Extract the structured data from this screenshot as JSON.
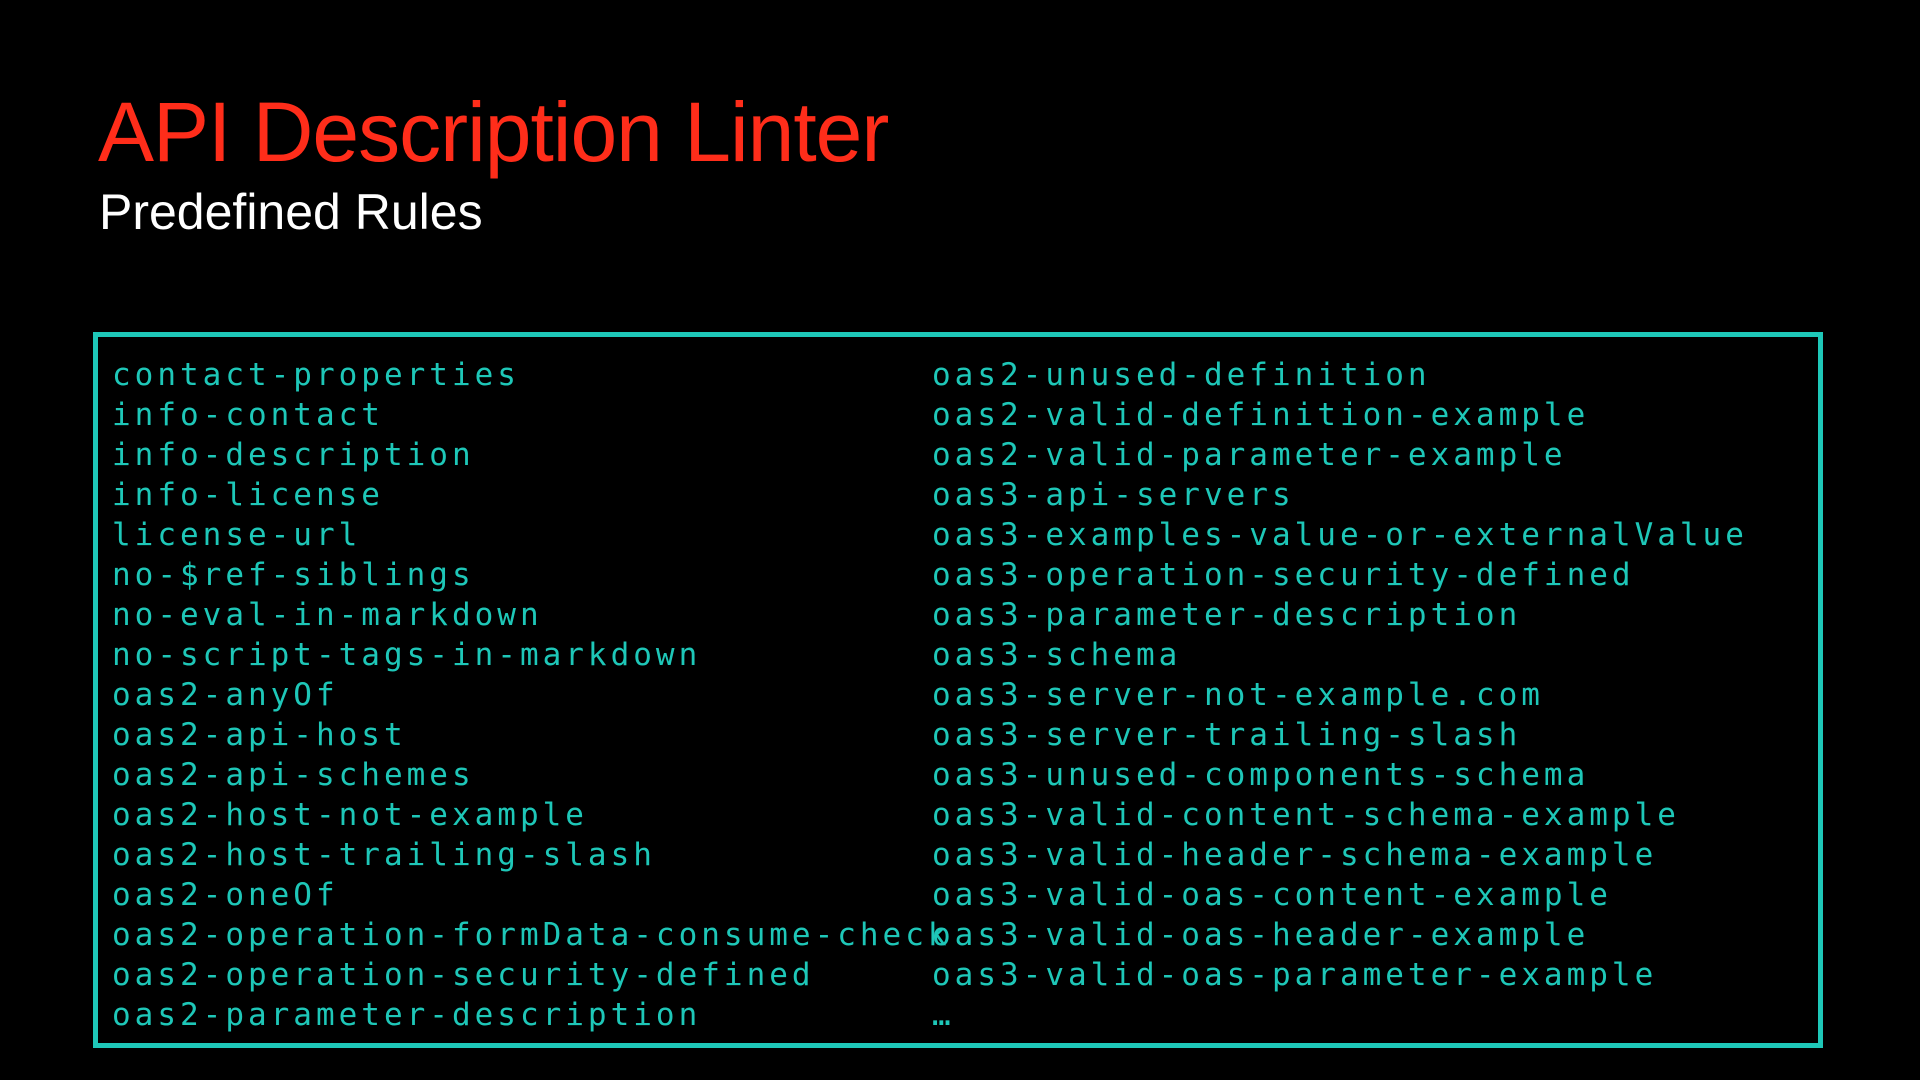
{
  "slide": {
    "title": "API Description Linter",
    "subtitle": "Predefined Rules"
  },
  "colors": {
    "background": "#000000",
    "title": "#ff2d1a",
    "subtitle": "#ffffff",
    "accent": "#1ec7b8"
  },
  "rules": {
    "left": [
      "contact-properties",
      "info-contact",
      "info-description",
      "info-license",
      "license-url",
      "no-$ref-siblings",
      "no-eval-in-markdown",
      "no-script-tags-in-markdown",
      "oas2-anyOf",
      "oas2-api-host",
      "oas2-api-schemes",
      "oas2-host-not-example",
      "oas2-host-trailing-slash",
      "oas2-oneOf",
      "oas2-operation-formData-consume-check",
      "oas2-operation-security-defined",
      "oas2-parameter-description"
    ],
    "right": [
      "oas2-unused-definition",
      "oas2-valid-definition-example",
      "oas2-valid-parameter-example",
      "oas3-api-servers",
      "oas3-examples-value-or-externalValue",
      "oas3-operation-security-defined",
      "oas3-parameter-description",
      "oas3-schema",
      "oas3-server-not-example.com",
      "oas3-server-trailing-slash",
      "oas3-unused-components-schema",
      "oas3-valid-content-schema-example",
      "oas3-valid-header-schema-example",
      "oas3-valid-oas-content-example",
      "oas3-valid-oas-header-example",
      "oas3-valid-oas-parameter-example",
      "…"
    ]
  }
}
